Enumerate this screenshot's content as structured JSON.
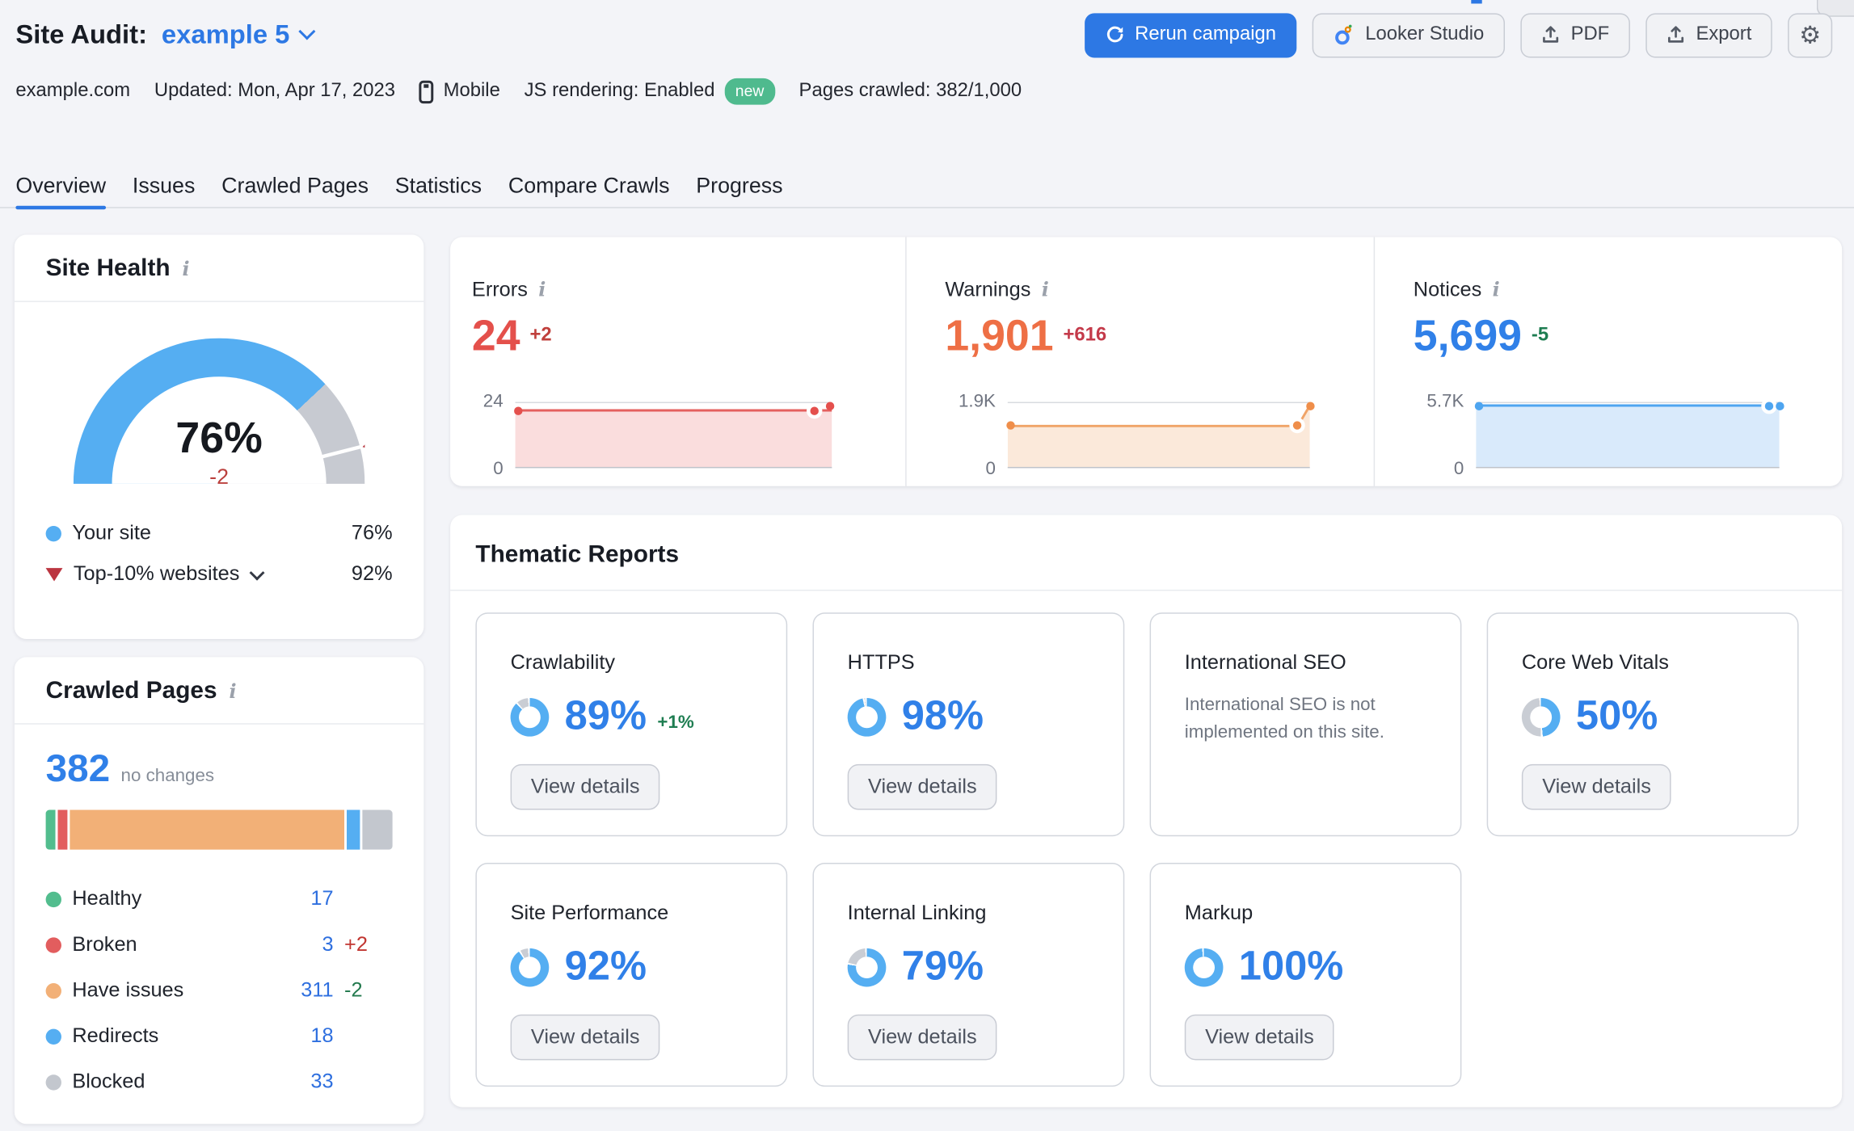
{
  "colors": {
    "accent_blue": "#2d78e4",
    "light_blue": "#55aef2",
    "link_blue": "#2e6fdf",
    "number_blue": "#3080e8",
    "errors_red": "#e4504b",
    "delta_red": "#c0403c",
    "warnings_orange": "#ee6f45",
    "warnings_delta_crimson": "#c43a4a",
    "green_badge": "#4fba8e",
    "delta_green": "#1e7d51",
    "gauge_gray": "#c7cad1",
    "benchmark_marker_red": "#b5333c"
  },
  "header": {
    "title": "Site Audit:",
    "project": "example 5",
    "rerun_label": "Rerun campaign",
    "looker_label": "Looker Studio",
    "pdf_label": "PDF",
    "export_label": "Export"
  },
  "meta": {
    "domain": "example.com",
    "updated": "Updated: Mon, Apr 17, 2023",
    "device": "Mobile",
    "js_rendering": "JS rendering: Enabled",
    "js_badge": "new",
    "pages_crawled": "Pages crawled: 382/1,000"
  },
  "tabs": [
    {
      "label": "Overview"
    },
    {
      "label": "Issues"
    },
    {
      "label": "Crawled Pages"
    },
    {
      "label": "Statistics"
    },
    {
      "label": "Compare Crawls"
    },
    {
      "label": "Progress"
    }
  ],
  "site_health": {
    "title": "Site Health",
    "score": "76%",
    "delta": "-2",
    "gauge_percent": "76",
    "benchmark_percent": "92",
    "legend": [
      {
        "label": "Your site",
        "value": "76%"
      },
      {
        "label": "Top-10% websites",
        "value": "92%"
      }
    ]
  },
  "crawled_pages": {
    "title": "Crawled Pages",
    "total": "382",
    "note": "no changes",
    "bar": [
      {
        "name": "healthy",
        "width": "2.9"
      },
      {
        "name": "broken",
        "width": "2.5"
      },
      {
        "name": "issues",
        "width": "79.4"
      },
      {
        "name": "redirects",
        "width": "4.0"
      },
      {
        "name": "blocked",
        "width": "8.7"
      }
    ],
    "legend": [
      {
        "label": "Healthy",
        "value": "17",
        "delta": ""
      },
      {
        "label": "Broken",
        "value": "3",
        "delta": "+2"
      },
      {
        "label": "Have issues",
        "value": "311",
        "delta": "-2"
      },
      {
        "label": "Redirects",
        "value": "18",
        "delta": ""
      },
      {
        "label": "Blocked",
        "value": "33",
        "delta": ""
      }
    ]
  },
  "summary": {
    "panels": [
      {
        "title": "Errors",
        "value": "24",
        "delta": "+2",
        "y_max": "24",
        "y_min": "0",
        "chart": {
          "line": "0,7 100,7",
          "fill": "0,7 100,7 100,55 0,55",
          "dots": [
            {
              "x": "1%",
              "y": "13%"
            },
            {
              "x": "94.5%",
              "y": "13%"
            },
            {
              "x": "99.5%",
              "y": "6%"
            }
          ]
        }
      },
      {
        "title": "Warnings",
        "value": "1,901",
        "delta": "+616",
        "y_max": "1.9K",
        "y_min": "0",
        "chart": {
          "line": "0,20 96,20 100,3",
          "fill": "0,20 96,20 100,3 100,55 0,55",
          "dots": [
            {
              "x": "1%",
              "y": "36%"
            },
            {
              "x": "96%",
              "y": "36%"
            },
            {
              "x": "100%",
              "y": "6%"
            }
          ]
        }
      },
      {
        "title": "Notices",
        "value": "5,699",
        "delta": "-5",
        "y_max": "5.7K",
        "y_min": "0",
        "chart": {
          "line": "0,3 100,3",
          "fill": "0,3 100,3 100,55 0,55",
          "dots": [
            {
              "x": "1%",
              "y": "6%"
            },
            {
              "x": "96.5%",
              "y": "6%"
            },
            {
              "x": "100%",
              "y": "6%"
            }
          ]
        }
      }
    ]
  },
  "thematic": {
    "title": "Thematic Reports",
    "button_label": "View details",
    "cards": [
      {
        "title": "Crawlability",
        "percent": "89%",
        "percent_value": "89",
        "delta": "+1%"
      },
      {
        "title": "HTTPS",
        "percent": "98%",
        "percent_value": "98"
      },
      {
        "title": "International SEO",
        "message": "International SEO is not implemented on this site."
      },
      {
        "title": "Core Web Vitals",
        "percent": "50%",
        "percent_value": "50"
      },
      {
        "title": "Site Performance",
        "percent": "92%",
        "percent_value": "92"
      },
      {
        "title": "Internal Linking",
        "percent": "79%",
        "percent_value": "79"
      },
      {
        "title": "Markup",
        "percent": "100%",
        "percent_value": "100"
      }
    ]
  }
}
